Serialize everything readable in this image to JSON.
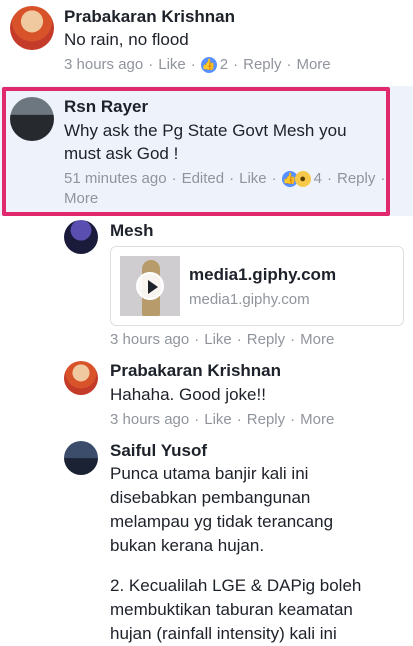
{
  "comments": [
    {
      "name": "Prabakaran Krishnan",
      "text": "No rain, no flood",
      "time": "3 hours ago",
      "like": "Like",
      "reply": "Reply",
      "more": "More",
      "reaction_count": "2"
    },
    {
      "name": "Rsn Rayer",
      "text": "Why ask the Pg State Govt Mesh you must ask God !",
      "time": "51 minutes ago",
      "edited": "Edited",
      "like": "Like",
      "reply": "Reply",
      "more": "More",
      "reaction_count": "4"
    }
  ],
  "replies": [
    {
      "name": "Mesh",
      "link": {
        "title": "media1.giphy.com",
        "domain": "media1.giphy.com"
      },
      "time": "3 hours ago",
      "like": "Like",
      "reply": "Reply",
      "more": "More"
    },
    {
      "name": "Prabakaran Krishnan",
      "text": "Hahaha. Good joke!!",
      "time": "3 hours ago",
      "like": "Like",
      "reply": "Reply",
      "more": "More"
    },
    {
      "name": "Saiful Yusof",
      "paragraph1": "Punca utama banjir kali ini disebabkan pembangunan melampau yg tidak terancang bukan kerana hujan.",
      "paragraph2": "2. Kecualilah LGE & DAPig boleh membuktikan taburan keamatan hujan (rainfall intensity) kali ini"
    }
  ],
  "colors": {
    "highlight_border": "#e0296d",
    "highlight_bg": "#eef3fb",
    "meta_text": "#90949c",
    "like_reaction": "#5890ff",
    "wow_reaction": "#f7c94a"
  },
  "icons": {
    "like": "thumbs-up-icon",
    "wow": "wow-face-icon",
    "play": "play-icon"
  }
}
